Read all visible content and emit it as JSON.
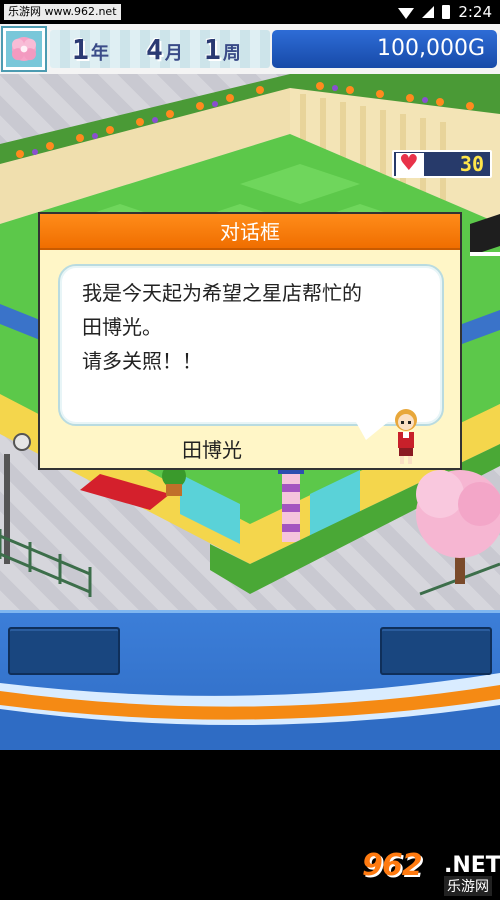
{
  "status_bar": {
    "watermark_text": "乐游网 www.962.net",
    "time": "2:24"
  },
  "hud": {
    "year_value": "1",
    "year_unit": "年",
    "month_value": "4",
    "month_unit": "月",
    "week_value": "1",
    "week_unit": "周",
    "money": "100,000G",
    "hearts_value": "30"
  },
  "dialog": {
    "title": "对话框",
    "message": "我是今天起为希望之星店帮忙的\n田博光。\n请多关照！！",
    "speaker": "田博光"
  },
  "watermark": {
    "main": "962",
    "suffix": ".NET",
    "sub": "乐游网"
  },
  "colors": {
    "dialog_title_bg": "#f07800",
    "money_bg": "#2559c0",
    "panel_bg": "#3674cc",
    "grass": "#5cc84a"
  }
}
